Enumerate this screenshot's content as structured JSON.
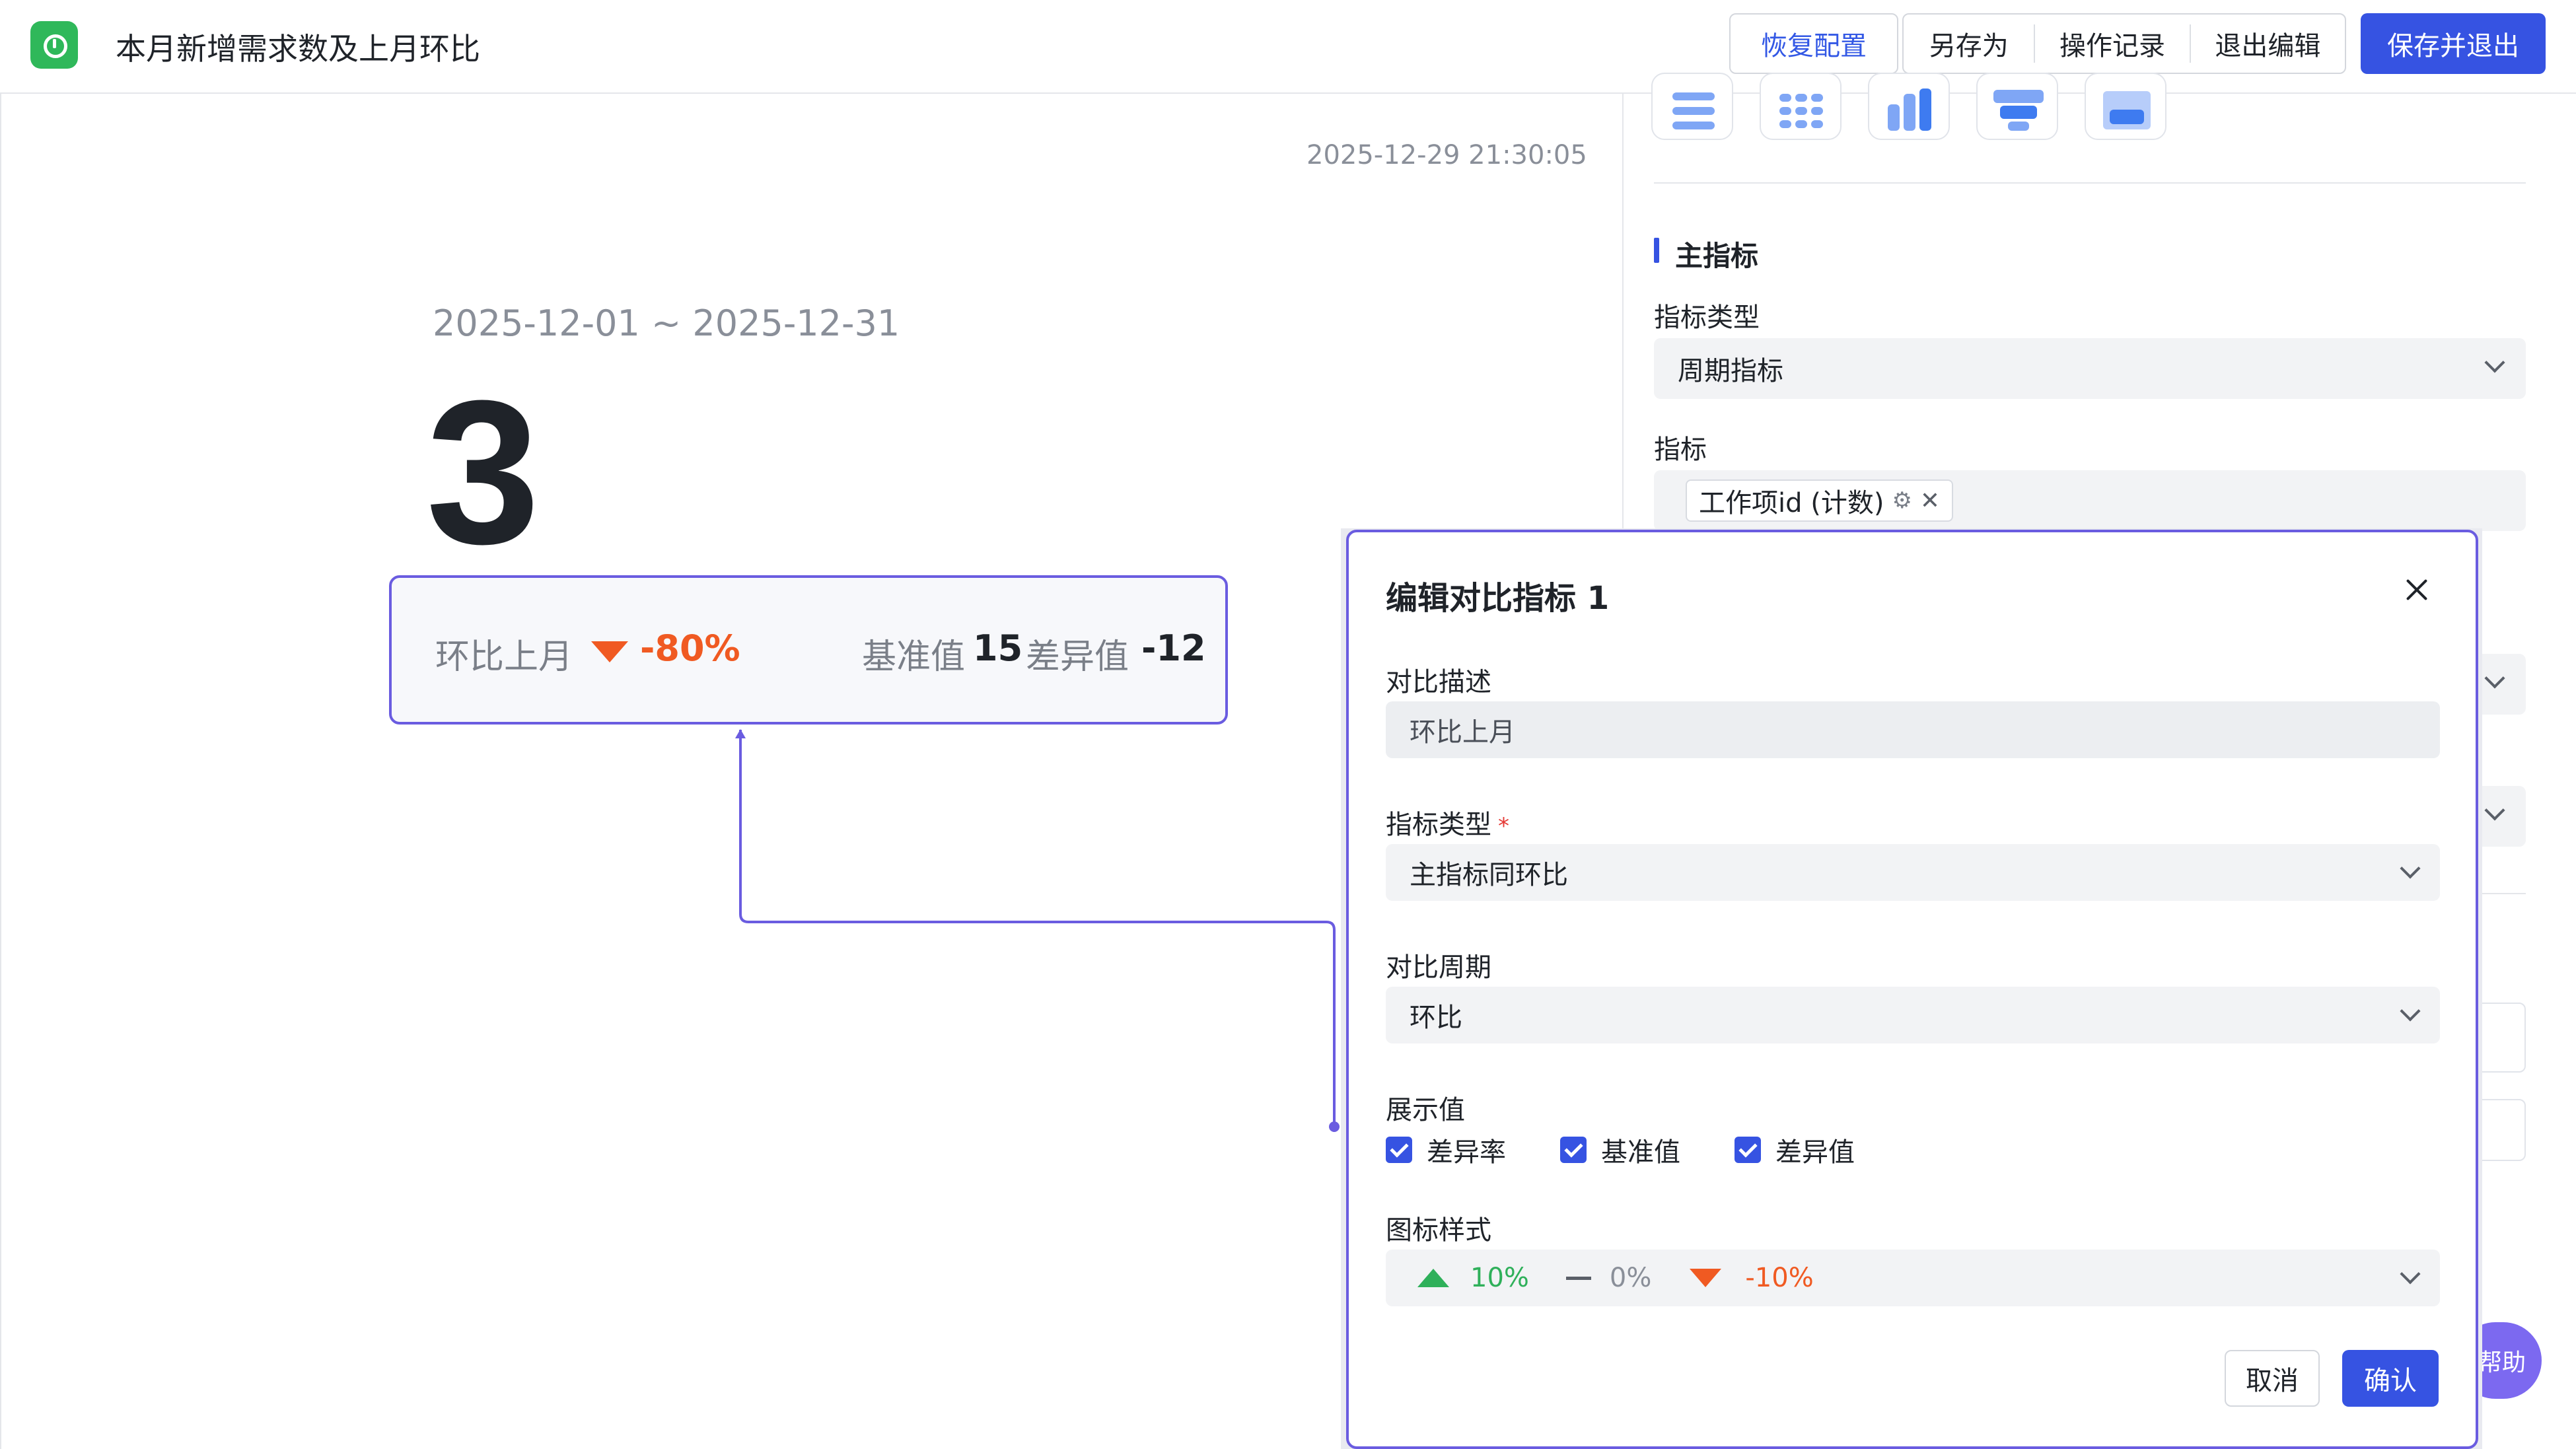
{
  "header": {
    "title": "本月新增需求数及上月环比",
    "restore_label": "恢复配置",
    "save_as_label": "另存为",
    "history_label": "操作记录",
    "exit_edit_label": "退出编辑",
    "save_exit_label": "保存并退出",
    "accent_color": "#3653e2"
  },
  "card": {
    "timestamp": "2025-12-29 21:30:05",
    "date_range": "2025-12-01 ~ 2025-12-31",
    "value": "3",
    "compare": {
      "label": "环比上月",
      "rate": "-80%",
      "base_label": "基准值",
      "base_value": "15",
      "diff_label": "差异值",
      "diff_value": "-12",
      "down_color": "#f05a22"
    }
  },
  "panel": {
    "section_title": "主指标",
    "metric_type_label": "指标类型",
    "metric_type_value": "周期指标",
    "metric_label": "指标",
    "metric_tag": "工作项id (计数)",
    "help_label": "帮助"
  },
  "modal": {
    "title": "编辑对比指标 1",
    "desc_label": "对比描述",
    "desc_value": "环比上月",
    "type_label": "指标类型",
    "type_required": "*",
    "type_value": "主指标同环比",
    "period_label": "对比周期",
    "period_value": "环比",
    "display_label": "展示值",
    "display_options": [
      "差异率",
      "基准值",
      "差异值"
    ],
    "icon_style_label": "图标样式",
    "icon_style": {
      "up": "10%",
      "flat": "0%",
      "down": "-10%",
      "up_color": "#2fb05a",
      "down_color": "#f05a22"
    },
    "cancel_label": "取消",
    "confirm_label": "确认"
  }
}
